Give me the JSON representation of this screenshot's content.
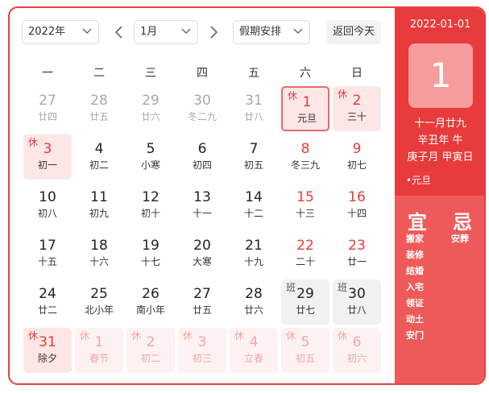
{
  "toolbar": {
    "year": "2022年",
    "month": "1月",
    "holiday": "假期安排",
    "today": "返回今天"
  },
  "weekdays": [
    "一",
    "二",
    "三",
    "四",
    "五",
    "六",
    "日"
  ],
  "days": [
    {
      "n": "27",
      "l": "廿四",
      "t": "other"
    },
    {
      "n": "28",
      "l": "廿五",
      "t": "other"
    },
    {
      "n": "29",
      "l": "廿六",
      "t": "other"
    },
    {
      "n": "30",
      "l": "冬二九",
      "t": "other"
    },
    {
      "n": "31",
      "l": "廿八",
      "t": "other"
    },
    {
      "n": "1",
      "l": "元旦",
      "t": "rest selected",
      "tag": "休"
    },
    {
      "n": "2",
      "l": "三十",
      "t": "rest",
      "tag": "休"
    },
    {
      "n": "3",
      "l": "初一",
      "t": "rest",
      "tag": "休"
    },
    {
      "n": "4",
      "l": "初二",
      "t": ""
    },
    {
      "n": "5",
      "l": "小寒",
      "t": ""
    },
    {
      "n": "6",
      "l": "初四",
      "t": ""
    },
    {
      "n": "7",
      "l": "初五",
      "t": ""
    },
    {
      "n": "8",
      "l": "冬三九",
      "t": "weekend"
    },
    {
      "n": "9",
      "l": "初七",
      "t": "weekend"
    },
    {
      "n": "10",
      "l": "初八",
      "t": ""
    },
    {
      "n": "11",
      "l": "初九",
      "t": ""
    },
    {
      "n": "12",
      "l": "初十",
      "t": ""
    },
    {
      "n": "13",
      "l": "十一",
      "t": ""
    },
    {
      "n": "14",
      "l": "十二",
      "t": ""
    },
    {
      "n": "15",
      "l": "十三",
      "t": "weekend"
    },
    {
      "n": "16",
      "l": "十四",
      "t": "weekend"
    },
    {
      "n": "17",
      "l": "十五",
      "t": ""
    },
    {
      "n": "18",
      "l": "十六",
      "t": ""
    },
    {
      "n": "19",
      "l": "十七",
      "t": ""
    },
    {
      "n": "20",
      "l": "大寒",
      "t": ""
    },
    {
      "n": "21",
      "l": "十九",
      "t": ""
    },
    {
      "n": "22",
      "l": "二十",
      "t": "weekend"
    },
    {
      "n": "23",
      "l": "廿一",
      "t": "weekend"
    },
    {
      "n": "24",
      "l": "廿二",
      "t": ""
    },
    {
      "n": "25",
      "l": "北小年",
      "t": ""
    },
    {
      "n": "26",
      "l": "南小年",
      "t": ""
    },
    {
      "n": "27",
      "l": "廿五",
      "t": ""
    },
    {
      "n": "28",
      "l": "廿六",
      "t": ""
    },
    {
      "n": "29",
      "l": "廿七",
      "t": "work",
      "tag": "班"
    },
    {
      "n": "30",
      "l": "廿八",
      "t": "work",
      "tag": "班"
    },
    {
      "n": "31",
      "l": "除夕",
      "t": "rest",
      "tag": "休"
    },
    {
      "n": "1",
      "l": "春节",
      "t": "rest other",
      "tag": "休"
    },
    {
      "n": "2",
      "l": "初二",
      "t": "rest other",
      "tag": "休"
    },
    {
      "n": "3",
      "l": "初三",
      "t": "rest other",
      "tag": "休"
    },
    {
      "n": "4",
      "l": "立春",
      "t": "rest other",
      "tag": "休"
    },
    {
      "n": "5",
      "l": "初五",
      "t": "rest other",
      "tag": "休"
    },
    {
      "n": "6",
      "l": "初六",
      "t": "rest other",
      "tag": "休"
    }
  ],
  "panel": {
    "date": "2022-01-01",
    "day": "1",
    "lunar": "十一月廿九",
    "ganzhi_year": "辛丑年 牛",
    "ganzhi_month_day": "庚子月 甲寅日",
    "festival": "•元旦",
    "yi_title": "宜",
    "ji_title": "忌",
    "yi": [
      "搬家",
      "装修",
      "结婚",
      "入宅",
      "领证",
      "动土",
      "安门"
    ],
    "ji": [
      "安葬"
    ]
  },
  "colors": {
    "accent": "#e83b3b",
    "rest_bg": "#fde6e6",
    "work_bg": "#f1f1f1"
  }
}
